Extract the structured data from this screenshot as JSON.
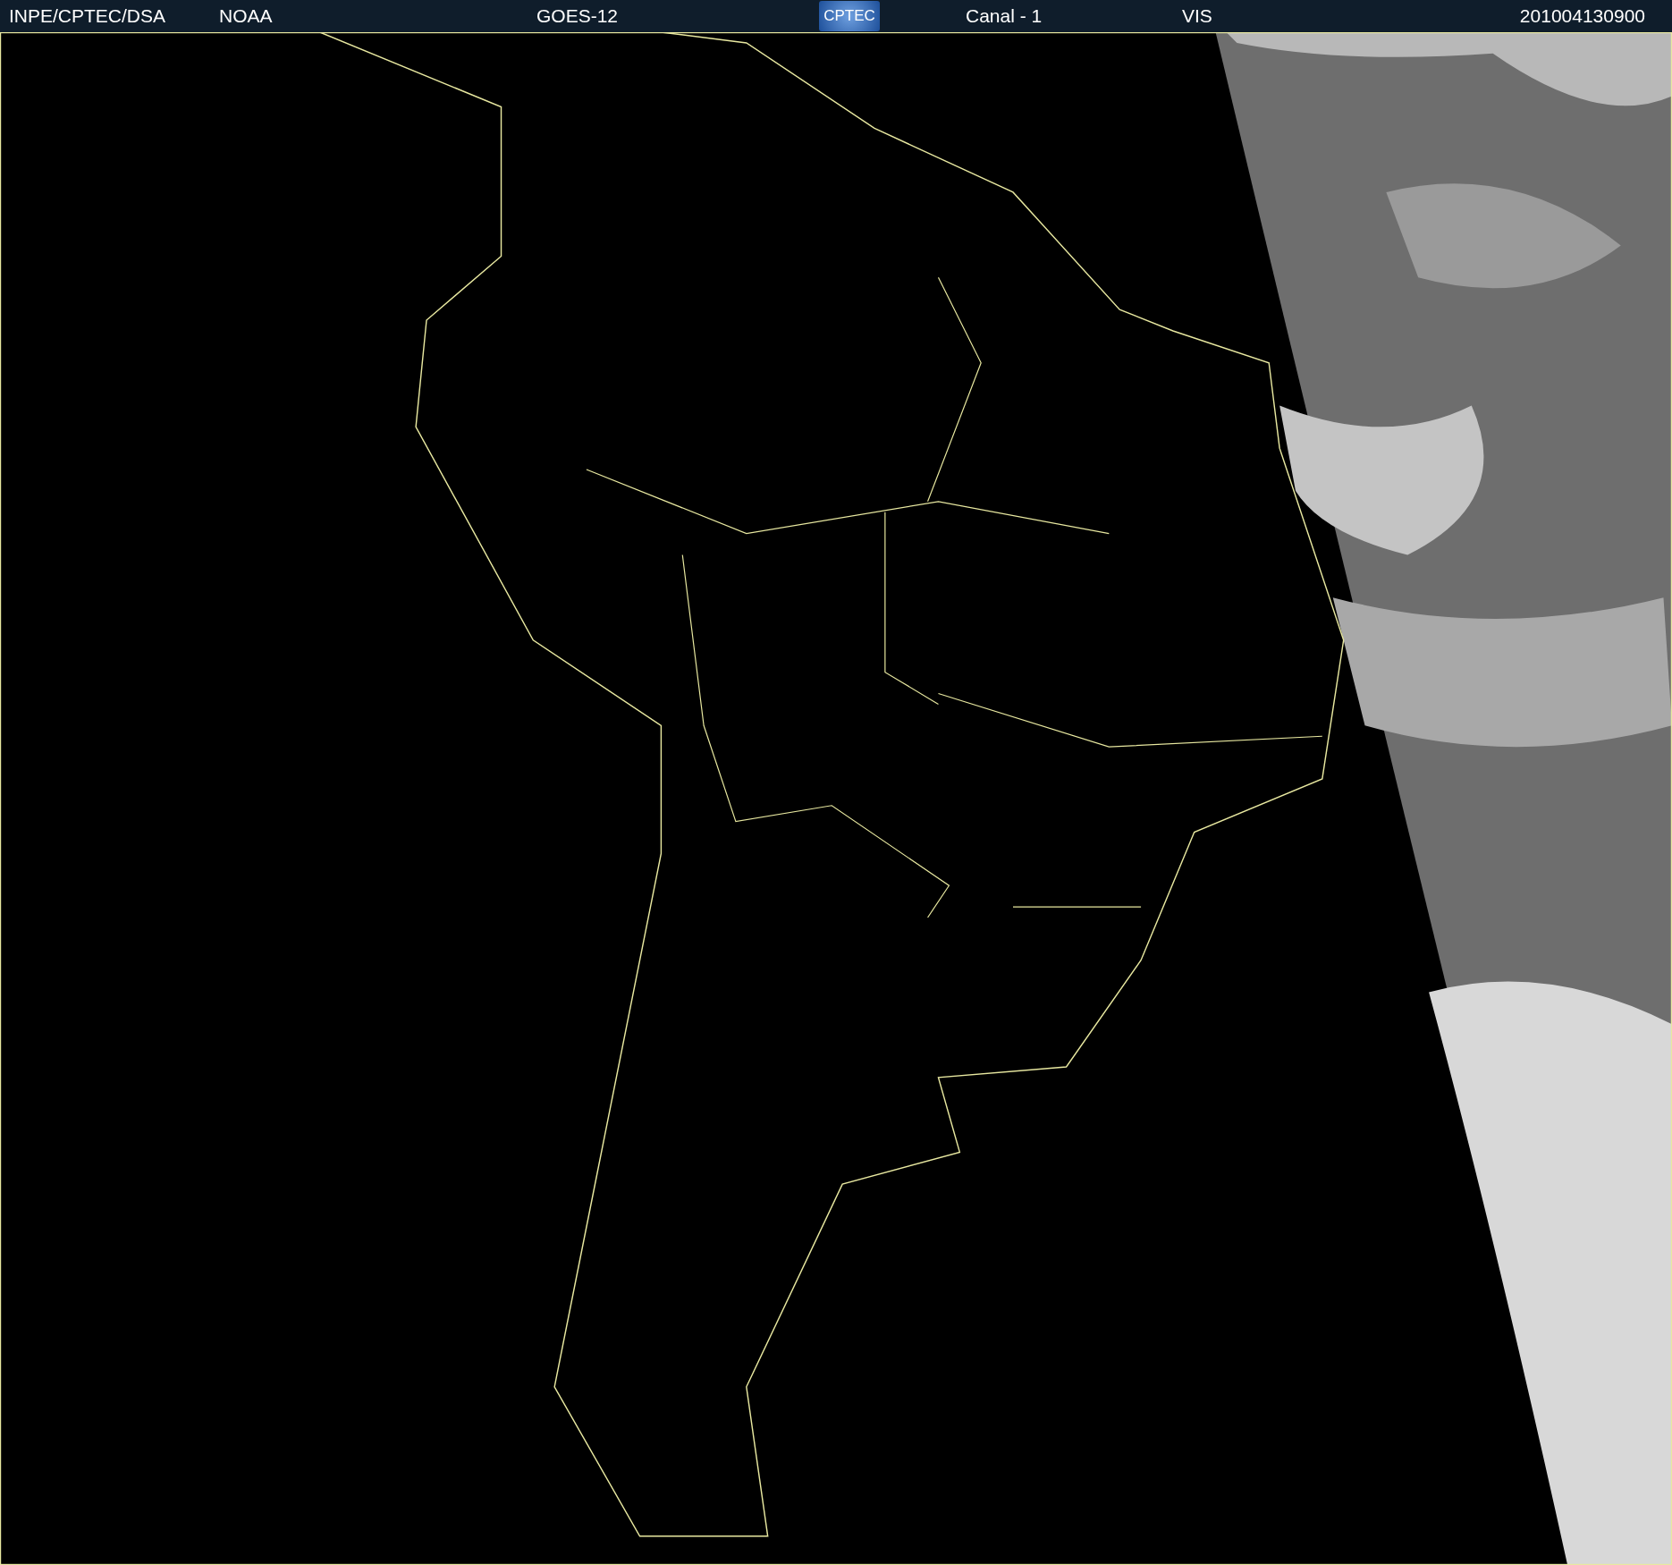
{
  "header": {
    "source": "INPE/CPTEC/DSA",
    "agency": "NOAA",
    "satellite": "GOES-12",
    "logo_text": "CPTEC",
    "channel": "Canal - 1",
    "band": "VIS",
    "timestamp": "201004130900"
  }
}
